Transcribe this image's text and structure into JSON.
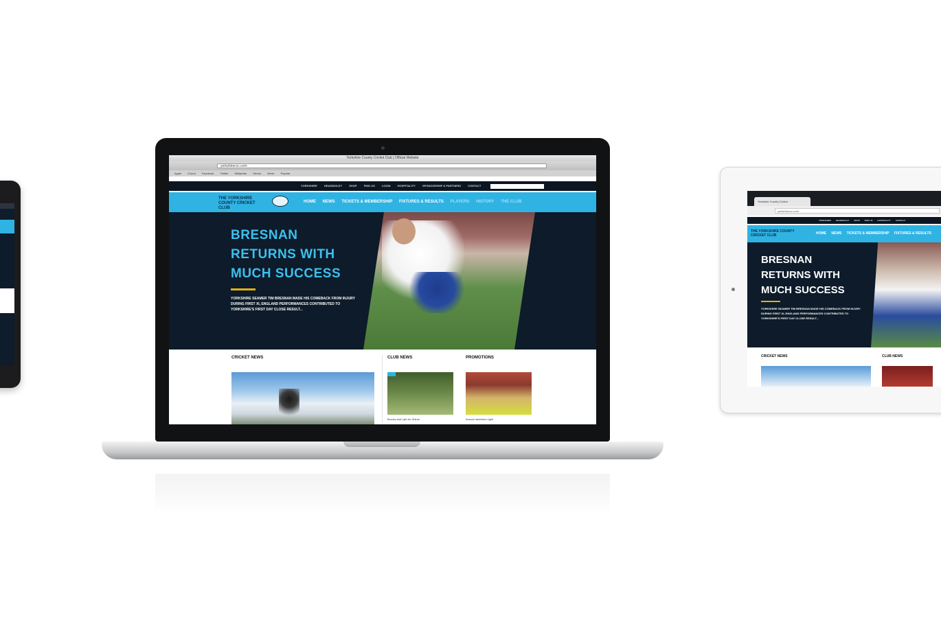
{
  "laptop": {
    "browser_title": "Yorkshire County Cricket Club | Official Website",
    "url": "yorkshireccc.com",
    "bookmarks": [
      "Apple",
      "iCloud",
      "Facebook",
      "Twitter",
      "Wikipedia",
      "Yahoo!",
      "News",
      "Popular"
    ],
    "utility_links": [
      "YORKSHIRE",
      "HEADINGLEY",
      "SHOP",
      "FIND US",
      "LOGIN",
      "HOSPITALITY",
      "SPONSORSHIP & PARTNERS",
      "CONTACT"
    ],
    "logo_text": "THE YORKSHIRE COUNTY CRICKET CLUB",
    "nav": {
      "home": "HOME",
      "news": "NEWS",
      "tickets": "TICKETS & MEMBERSHIP",
      "fixtures": "FIXTURES & RESULTS",
      "players": "PLAYERS",
      "history": "HISTORY",
      "the_club": "THE CLUB"
    },
    "hero": {
      "title": "BRESNAN RETURNS WITH MUCH SUCCESS",
      "text": "YORKSHIRE SEAMER TIM BRESNAN MADE HIS COMEBACK FROM INJURY DURING FIRST XI, ENGLAND PERFORMANCES CONTRIBUTED TO YORKSHIRE'S FIRST DAY CLOSE RESULT..."
    },
    "sections": {
      "cricket_news": "CRICKET NEWS",
      "club_news": "CLUB NEWS",
      "promotions": "PROMOTIONS"
    },
    "captions": {
      "club": "Brooks and Lyth for Shires",
      "promo": "Annual members night"
    }
  },
  "tablet": {
    "tab_title": "Yorkshire County Cricket",
    "url": "yorkshireccc.com",
    "utility_links": [
      "YORKSHIRE",
      "HEADINGLEY",
      "SHOP",
      "FIND US",
      "HOSPITALITY",
      "CONTACT"
    ],
    "logo_text": "THE YORKSHIRE COUNTY CRICKET CLUB",
    "nav": [
      "HOME",
      "NEWS",
      "TICKETS & MEMBERSHIP",
      "FIXTURES & RESULTS"
    ],
    "hero_title": "BRESNAN RETURNS WITH MUCH SUCCESS",
    "hero_text": "YORKSHIRE SEAMER TIM BRESNAN MADE HIS COMEBACK FROM INJURY DURING FIRST XI, ENGLAND PERFORMANCES CONTRIBUTED TO YORKSHIRE'S FIRST DAY CLOSE RESULT...",
    "sections": {
      "cricket_news": "CRICKET NEWS",
      "club_news": "CLUB NEWS"
    }
  },
  "colors": {
    "brand_blue": "#2fb3e3",
    "navy": "#0d1b2a",
    "accent_gold": "#e7b20c"
  }
}
